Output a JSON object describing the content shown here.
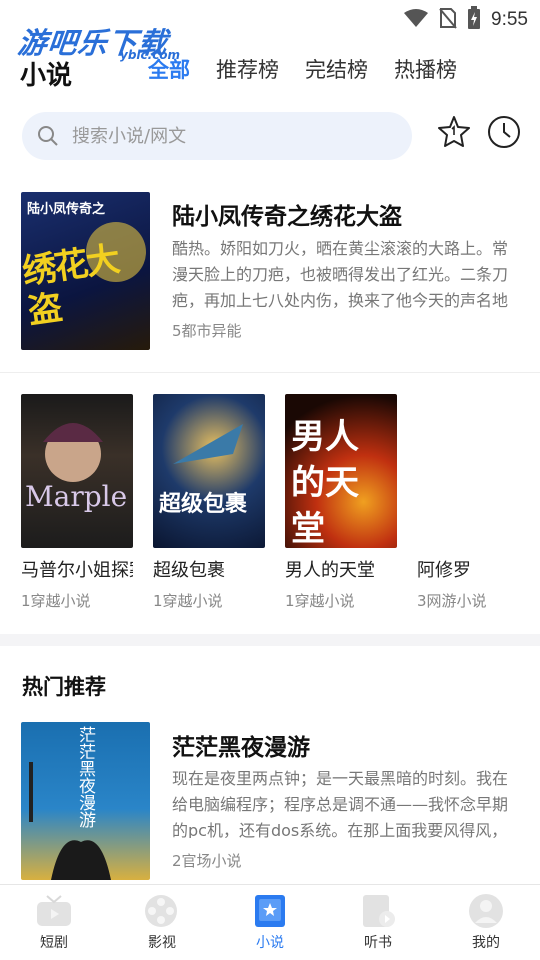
{
  "status": {
    "time": "9:55"
  },
  "watermark": {
    "text": "游吧乐下载",
    "sub": "yblc.com"
  },
  "header": {
    "title": "小说",
    "tabs": [
      {
        "label": "全部",
        "active": true
      },
      {
        "label": "推荐榜",
        "active": false
      },
      {
        "label": "完结榜",
        "active": false
      },
      {
        "label": "热播榜",
        "active": false
      }
    ]
  },
  "search": {
    "placeholder": "搜索小说/网文",
    "icon": "search-icon"
  },
  "actions": {
    "favorites_icon": "star-icon",
    "history_icon": "clock-icon"
  },
  "featured": {
    "title": "陆小凤传奇之绣花大盗",
    "cover_text": "陆小凤传奇之",
    "cover_big": "绣花大盗",
    "description": "酷热。娇阳如刀火，晒在黄尘滚滚的大路上。常漫天脸上的刀疤，也被晒得发出了红光。二条刀疤，再加上七八处内伤，换来了他今天的声名地位。大路旁边有个茶棚，也被晒得发烫，却被挤",
    "meta": "5都市异能"
  },
  "grid": [
    {
      "title": "马普尔小姐探案",
      "meta": "1穿越小说",
      "cover_text": "Marple"
    },
    {
      "title": "超级包裹",
      "meta": "1穿越小说",
      "cover_text": "超级包裹"
    },
    {
      "title": "男人的天堂",
      "meta": "1穿越小说",
      "cover_text": "男人的天堂"
    },
    {
      "title": "阿修罗",
      "meta": "3网游小说",
      "cover_text": ""
    }
  ],
  "hot": {
    "section_title": "热门推荐",
    "title": "茫茫黑夜漫游",
    "cover_text": "茫茫黑夜漫游",
    "description": "现在是夜里两点钟；是一天最黑暗的时刻。我在给电脑编程序；程序总是调不通——我怀念早期的pc机，还有dos系统。在那上面我要风得风，要雨得雨。现在的操作系统复杂得让人头疼。",
    "meta": "2官场小说"
  },
  "bottom_nav": [
    {
      "label": "短剧",
      "icon": "short-drama-icon",
      "active": false
    },
    {
      "label": "影视",
      "icon": "film-reel-icon",
      "active": false
    },
    {
      "label": "小说",
      "icon": "book-icon",
      "active": true
    },
    {
      "label": "听书",
      "icon": "audiobook-icon",
      "active": false
    },
    {
      "label": "我的",
      "icon": "profile-icon",
      "active": false
    }
  ],
  "colors": {
    "accent": "#2b7bf0",
    "search_bg": "#edf2fb",
    "muted": "#888888"
  }
}
